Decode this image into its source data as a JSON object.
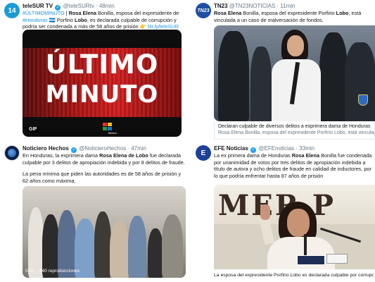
{
  "tweets": [
    {
      "avatar_text": "14",
      "name": "teleSUR TV",
      "handle": "@teleSURtv",
      "time": "· 48min",
      "text_parts": [
        "#ÚLTIMOMINUTO",
        " | ",
        "Rosa Elena",
        " Bonilla, esposa del expresidente de ",
        "#Honduras",
        " 🇭🇳 Porfirio ",
        "Lobo",
        ", es declarada culpable de corrupción y podría ser condenada a más de 58 años de prisión 👉 ",
        "bit.ly/teleSUR"
      ],
      "media": {
        "headline_line1": "ÚLTIMO",
        "headline_line2": "MINUTO",
        "badge": "GIF",
        "logo_label": "telesur"
      }
    },
    {
      "avatar_text": "TN23",
      "name": "TN23",
      "handle": "@TN23NOTICIAS",
      "time": "· 11min",
      "text_parts": [
        "Rosa Elena",
        " Bonilla, esposa del expresidente Porfirio ",
        "Lobo",
        ", está vinculada a un caso de malversación de fondos."
      ],
      "card": {
        "title": "Declaran culpable de diversos delitos a exprimera dama de Honduras",
        "description": "Rosa Elena Bonilla, esposa del expresidente Porfirio Lobo, está vinculada"
      }
    },
    {
      "name": "Noticiero Hechos",
      "handle": "@NoticieroHechos",
      "time": "· 47min",
      "text_parts": [
        "En Honduras, la exprimera dama ",
        "Rosa Elena de Lobo",
        " fue declarada culpable por 3 delitos de apropiación indebida y por 8 delitos de fraude."
      ],
      "text2": "La pena mínima que piden las autoridades es de 58 años de prisión y 62 años como máxima.",
      "media": {
        "duration": "0:31",
        "views": "940 reproducciones"
      }
    },
    {
      "avatar_text": "E",
      "name": "EFE Noticias",
      "handle": "@EFEnoticias",
      "time": "· 33min",
      "text_parts": [
        "La ex primera dama de Honduras ",
        "Rosa Elena",
        " Bonilla fue condenada por unanimidad de votos por tres delitos de apropiación indebida a título de autora y ocho delitos de fraude en calidad de inductores, por lo que podría enfrentar hasta 87 años de prisión"
      ],
      "media": {
        "sign_letters": "MER P"
      },
      "caption": "La esposa del expresidente Porfirio Lobo es declarada culpable por corrupción"
    }
  ],
  "colors": {
    "link": "#1b95e0",
    "verified": "#1da1f2",
    "handle": "#657786",
    "ultimo_red": "#d42020"
  }
}
